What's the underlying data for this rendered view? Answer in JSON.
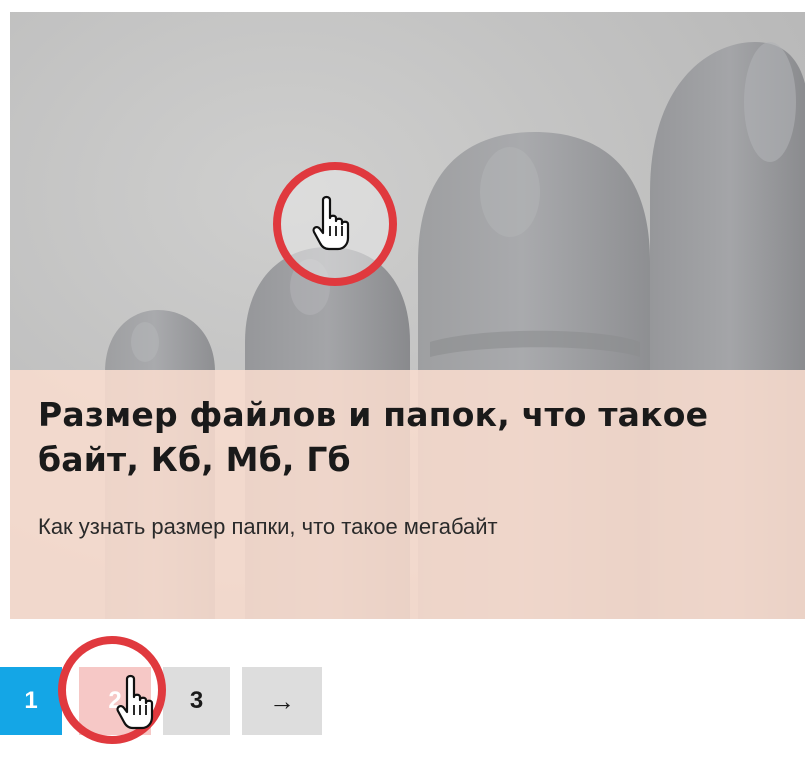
{
  "slide": {
    "title": "Размер файлов и папок, что такое байт, Кб, Мб, Гб",
    "subtitle": "Как узнать размер папки, что такое мегабайт"
  },
  "pagination": {
    "pages": [
      "1",
      "2",
      "3"
    ],
    "current_page": "1",
    "hovered_page": "2",
    "next_label": "→"
  },
  "colors": {
    "active_page": "#14a6e6",
    "hovered_page": "#f6c8c6",
    "inactive_page": "#dddddd",
    "highlight_ring": "#e0393e",
    "caption_background": "#fadccf"
  },
  "icons": {
    "cursor": "hand-pointer-icon",
    "highlight": "highlight-circle"
  }
}
